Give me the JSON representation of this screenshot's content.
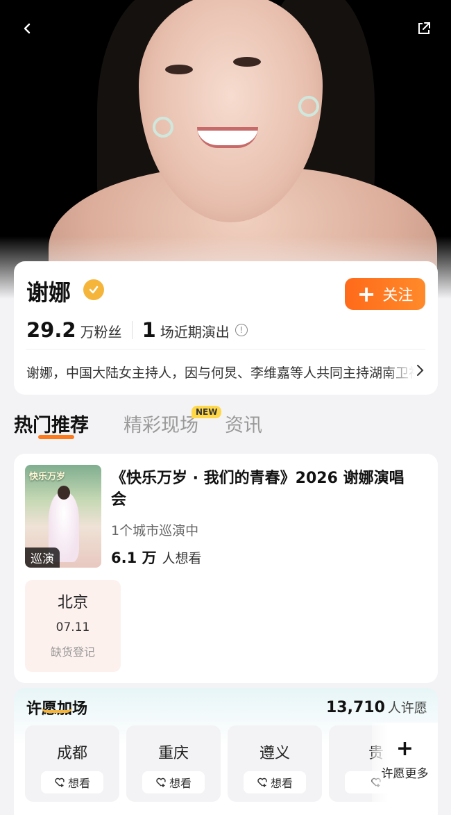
{
  "profile": {
    "name": "谢娜",
    "follow_label": "关注",
    "fans_num": "29.2",
    "fans_unit": "万粉丝",
    "shows_num": "1",
    "shows_unit": "场近期演出",
    "bio": "谢娜，中国大陆女主持人，因与何炅、李维嘉等人共同主持湖南卫视"
  },
  "tabs": [
    {
      "label": "热门推荐"
    },
    {
      "label": "精彩现场",
      "badge": "NEW"
    },
    {
      "label": "资讯"
    }
  ],
  "concert": {
    "poster_title": "快乐万岁",
    "poster_tag": "巡演",
    "title": "《快乐万岁 · 我们的青春》2026 谢娜演唱会",
    "subtitle": "1个城市巡演中",
    "want_num": "6.1 万",
    "want_unit": "人想看",
    "city": {
      "name": "北京",
      "date": "07.11",
      "status": "缺货登记"
    }
  },
  "wish": {
    "title": "许愿加场",
    "count_num": "13,710",
    "count_unit": "人许愿",
    "cities": [
      {
        "name": "成都",
        "btn": "想看"
      },
      {
        "name": "重庆",
        "btn": "想看"
      },
      {
        "name": "遵义",
        "btn": "想看"
      },
      {
        "name": "贵",
        "btn": ""
      }
    ],
    "more_label": "许愿更多"
  },
  "colors": {
    "accent": "#ff7a1a",
    "verify": "#f5b53a"
  }
}
